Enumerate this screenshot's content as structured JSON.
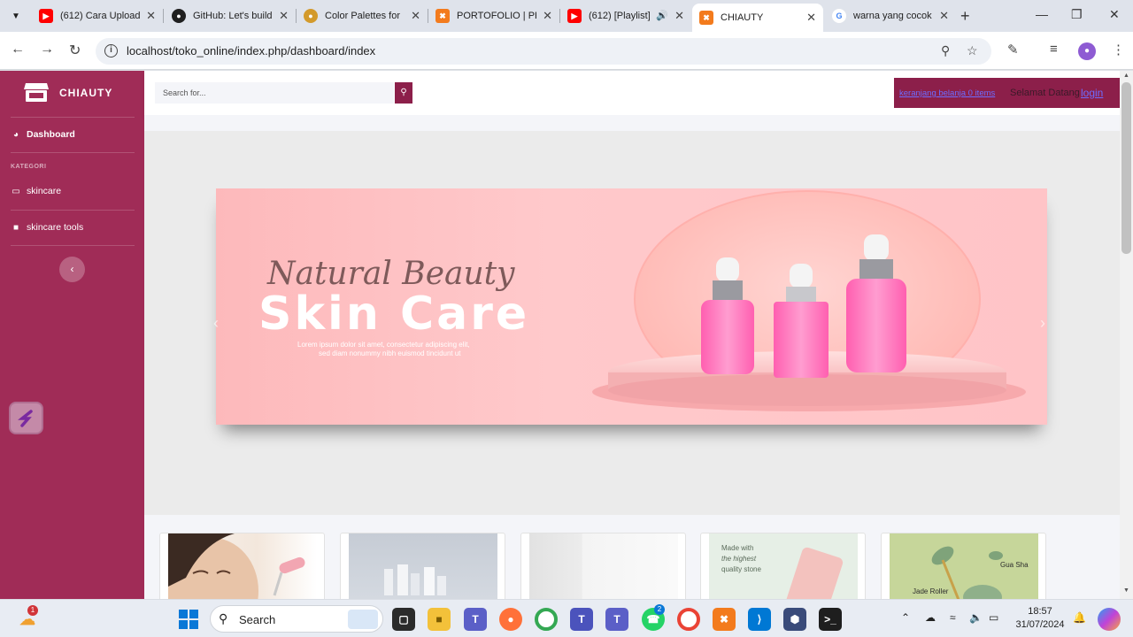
{
  "browser": {
    "tabs": [
      {
        "title": "(612) Cara Upload",
        "favicon": "youtube-icon",
        "color": "#ff0000"
      },
      {
        "title": "GitHub: Let's build",
        "favicon": "github-icon",
        "color": "#1f1f1f"
      },
      {
        "title": "Color Palettes for",
        "favicon": "palette-icon",
        "color": "#d39a2b"
      },
      {
        "title": "PORTOFOLIO | PH",
        "favicon": "xampp-icon",
        "color": "#f37b1d"
      },
      {
        "title": "(612) [Playlist]",
        "favicon": "youtube-icon",
        "color": "#ff0000"
      },
      {
        "title": "CHIAUTY",
        "favicon": "xampp-icon",
        "color": "#f37b1d"
      },
      {
        "title": "warna yang cocok",
        "favicon": "google-icon",
        "color": "#4285f4"
      }
    ],
    "active_tab": 5,
    "url": "localhost/toko_online/index.php/dashboard/index"
  },
  "sidebar": {
    "brand": "CHIAUTY",
    "dashboard_label": "Dashboard",
    "section_heading": "KATEGORI",
    "items": [
      {
        "label": "skincare",
        "icon": "monitor-icon"
      },
      {
        "label": "skincare tools",
        "icon": "shirt-icon"
      }
    ],
    "color": "#a02c57"
  },
  "topbar": {
    "search_placeholder": "Search for...",
    "cart_text": "keranjang belanja 0 items",
    "welcome_text": "Selamat Datang",
    "login_text": "login",
    "accent": "#8c1f4a"
  },
  "banner": {
    "script_text": "Natural Beauty",
    "headline": "Skin Care",
    "body_text_1": "Lorem ipsum dolor sit amet, consectetur adipiscing elit,",
    "body_text_2": "sed diam nonummy nibh euismod tincidunt ut"
  },
  "cards": [
    {
      "name": "face-roller-card"
    },
    {
      "name": "bottles-card"
    },
    {
      "name": "blank-product-card"
    },
    {
      "name": "gua-sha-card",
      "caption_1": "Made with",
      "caption_2": "the highest",
      "caption_3": "quality stone"
    },
    {
      "name": "jade-roller-card",
      "caption_1": "Gua Sha",
      "caption_2": "Jade Roller"
    }
  ],
  "taskbar": {
    "search_label": "Search",
    "time": "18:57",
    "date": "31/07/2024",
    "weather_badge": "1",
    "teams_badge": "2"
  }
}
